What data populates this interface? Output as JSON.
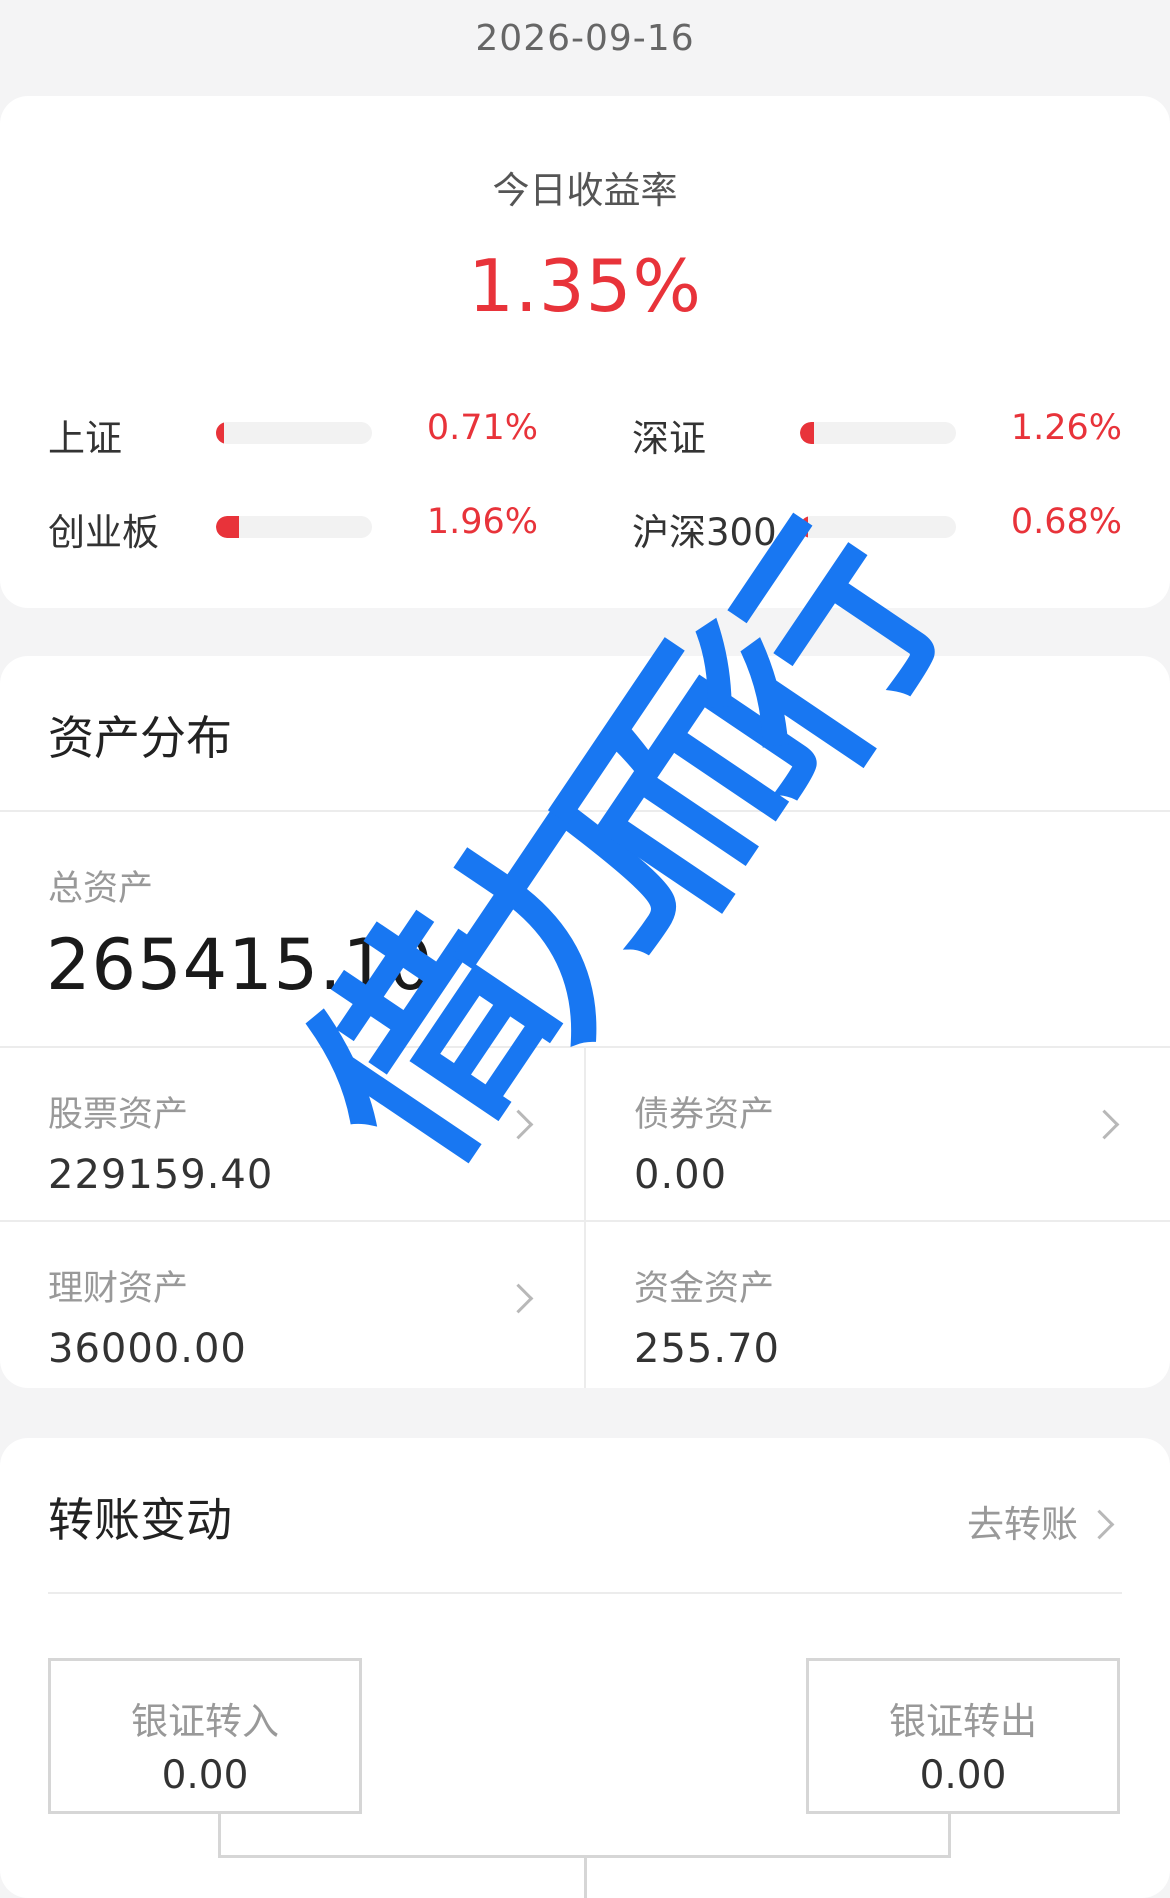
{
  "date": "2026-09-16",
  "today_rate": {
    "title": "今日收益率",
    "value": "1.35%"
  },
  "indices": [
    {
      "name": "上证",
      "value": "0.71%",
      "bar_fraction": 0.05
    },
    {
      "name": "深证",
      "value": "1.26%",
      "bar_fraction": 0.09
    },
    {
      "name": "创业板",
      "value": "1.96%",
      "bar_fraction": 0.15
    },
    {
      "name": "沪深300",
      "value": "0.68%",
      "bar_fraction": 0.05
    }
  ],
  "assets": {
    "title": "资产分布",
    "total_label": "总资产",
    "total_value": "265415.10",
    "items": [
      {
        "label": "股票资产",
        "value": "229159.40"
      },
      {
        "label": "债券资产",
        "value": "0.00"
      },
      {
        "label": "理财资产",
        "value": "36000.00"
      },
      {
        "label": "资金资产",
        "value": "255.70"
      }
    ]
  },
  "transfer": {
    "title": "转账变动",
    "action_label": "去转账",
    "in_label": "银证转入",
    "in_value": "0.00",
    "out_label": "银证转出",
    "out_value": "0.00"
  },
  "watermark": {
    "chars": [
      "借",
      "力",
      "而",
      "行"
    ],
    "color": "#1877f2"
  },
  "colors": {
    "up": "#e8333a",
    "background": "#f4f4f5"
  }
}
